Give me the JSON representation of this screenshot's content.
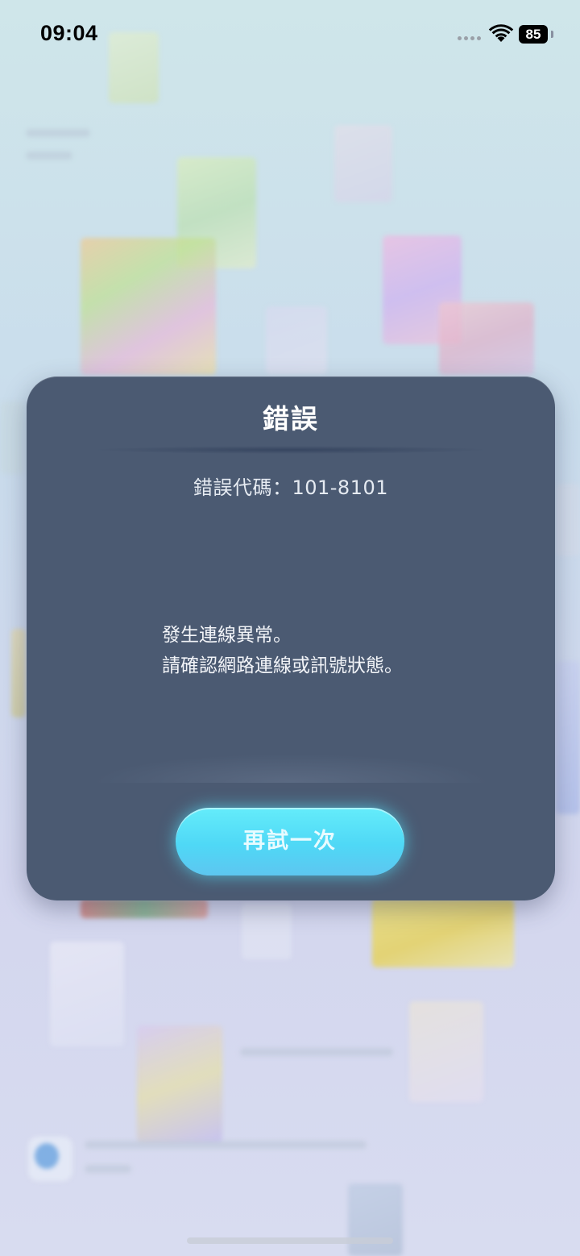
{
  "status_bar": {
    "time": "09:04",
    "battery": "85"
  },
  "dialog": {
    "title": "錯誤",
    "error_code": "錯誤代碼：101-8101",
    "message_line1": "發生連線異常。",
    "message_line2": "請確認網路連線或訊號狀態。",
    "retry_label": "再試一次"
  },
  "colors": {
    "dialog_bg": "#4b5a72",
    "button_accent": "#4fd8f6"
  }
}
